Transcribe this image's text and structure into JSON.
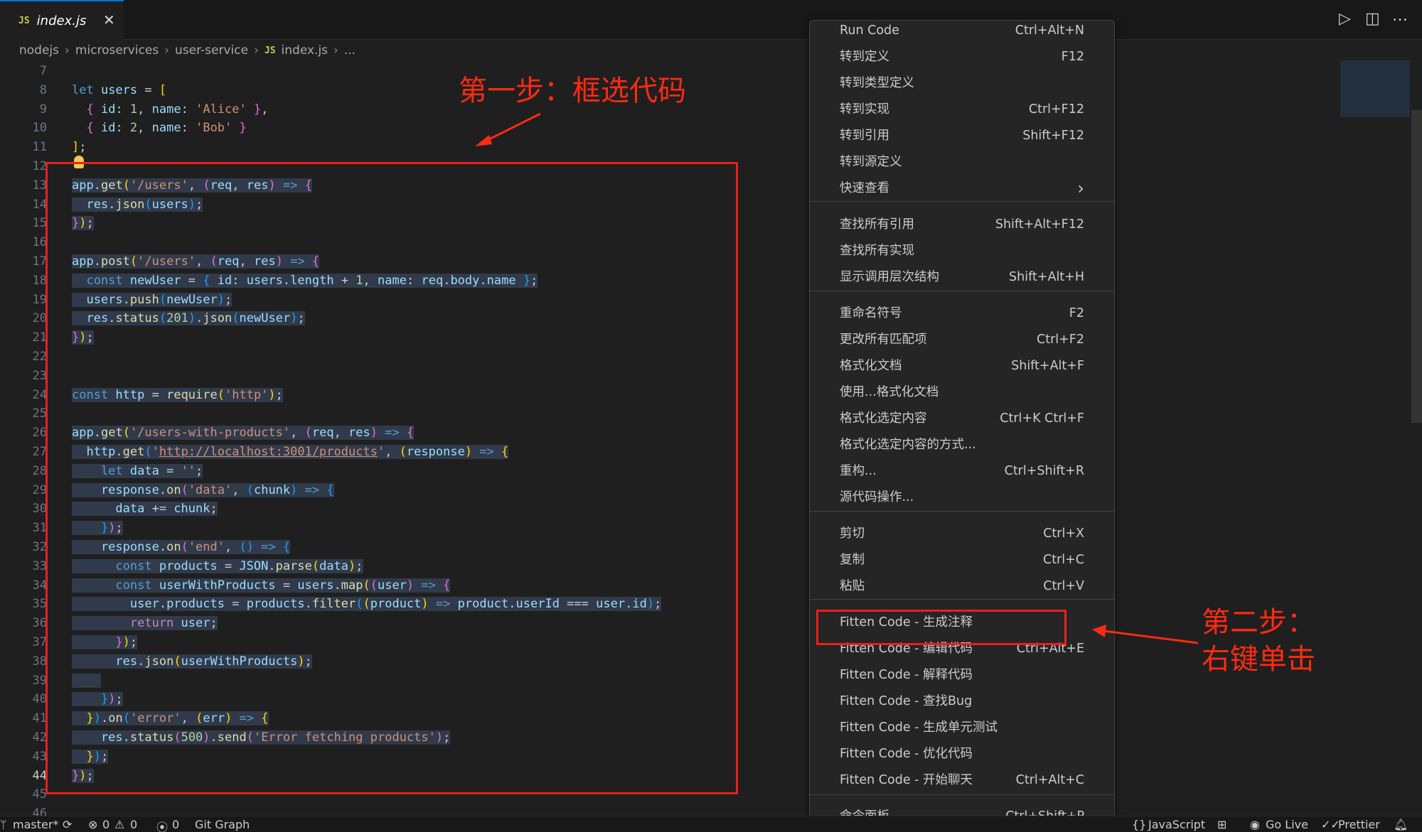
{
  "tab": {
    "badge": "JS",
    "name": "index.js",
    "close": "✕"
  },
  "toolbar": {
    "run": "▷",
    "split": "◫",
    "more": "…"
  },
  "breadcrumb": [
    "nodejs",
    "microservices",
    "user-service",
    "index.js",
    "..."
  ],
  "breadcrumb_badge": "JS",
  "gutter": [
    "7",
    "8",
    "9",
    "10",
    "11",
    "12",
    "13",
    "14",
    "15",
    "16",
    "17",
    "18",
    "19",
    "20",
    "21",
    "22",
    "23",
    "24",
    "25",
    "26",
    "27",
    "28",
    "29",
    "30",
    "31",
    "32",
    "33",
    "34",
    "35",
    "36",
    "37",
    "38",
    "39",
    "40",
    "41",
    "42",
    "43",
    "44",
    "45",
    "46"
  ],
  "annotations": {
    "step1": "第一步：框选代码",
    "step2_line1": "第二步：",
    "step2_line2": "右键单击"
  },
  "menu": {
    "items": [
      {
        "label": "Run Code",
        "shortcut": "Ctrl+Alt+N"
      },
      {
        "label": "转到定义",
        "shortcut": "F12"
      },
      {
        "label": "转到类型定义",
        "shortcut": ""
      },
      {
        "label": "转到实现",
        "shortcut": "Ctrl+F12"
      },
      {
        "label": "转到引用",
        "shortcut": "Shift+F12"
      },
      {
        "label": "转到源定义",
        "shortcut": ""
      },
      {
        "label": "快速查看",
        "shortcut": "›"
      },
      {
        "label": "查找所有引用",
        "shortcut": "Shift+Alt+F12"
      },
      {
        "label": "查找所有实现",
        "shortcut": ""
      },
      {
        "label": "显示调用层次结构",
        "shortcut": "Shift+Alt+H"
      },
      {
        "label": "重命名符号",
        "shortcut": "F2"
      },
      {
        "label": "更改所有匹配项",
        "shortcut": "Ctrl+F2"
      },
      {
        "label": "格式化文档",
        "shortcut": "Shift+Alt+F"
      },
      {
        "label": "使用...格式化文档",
        "shortcut": ""
      },
      {
        "label": "格式化选定内容",
        "shortcut": "Ctrl+K Ctrl+F"
      },
      {
        "label": "格式化选定内容的方式...",
        "shortcut": ""
      },
      {
        "label": "重构...",
        "shortcut": "Ctrl+Shift+R"
      },
      {
        "label": "源代码操作...",
        "shortcut": ""
      },
      {
        "label": "剪切",
        "shortcut": "Ctrl+X"
      },
      {
        "label": "复制",
        "shortcut": "Ctrl+C"
      },
      {
        "label": "粘贴",
        "shortcut": "Ctrl+V"
      },
      {
        "label": "Fitten Code - 生成注释",
        "shortcut": ""
      },
      {
        "label": "Fitten Code - 编辑代码",
        "shortcut": "Ctrl+Alt+E"
      },
      {
        "label": "Fitten Code - 解释代码",
        "shortcut": ""
      },
      {
        "label": "Fitten Code - 查找Bug",
        "shortcut": ""
      },
      {
        "label": "Fitten Code - 生成单元测试",
        "shortcut": ""
      },
      {
        "label": "Fitten Code - 优化代码",
        "shortcut": ""
      },
      {
        "label": "Fitten Code - 开始聊天",
        "shortcut": "Ctrl+Alt+C"
      },
      {
        "label": "命令面板...",
        "shortcut": "Ctrl+Shift+P"
      }
    ]
  },
  "status": {
    "branch": "master*",
    "errors": "0",
    "warnings": "0",
    "ports": "0",
    "git_graph": "Git Graph",
    "language": "JavaScript",
    "golive": "Go Live",
    "prettier": "Prettier"
  },
  "code": [
    [],
    [
      [
        "let ",
        "k"
      ],
      [
        "users",
        "v"
      ],
      [
        " = ",
        "p"
      ],
      [
        "[",
        "b1"
      ]
    ],
    [
      [
        "  { ",
        "b2"
      ],
      [
        "id",
        "v"
      ],
      [
        ": ",
        "p"
      ],
      [
        "1",
        "n"
      ],
      [
        ", ",
        "p"
      ],
      [
        "name",
        "v"
      ],
      [
        ": ",
        "p"
      ],
      [
        "'Alice'",
        "s"
      ],
      [
        " }",
        "b2"
      ],
      [
        ",",
        "p"
      ]
    ],
    [
      [
        "  { ",
        "b2"
      ],
      [
        "id",
        "v"
      ],
      [
        ": ",
        "p"
      ],
      [
        "2",
        "n"
      ],
      [
        ", ",
        "p"
      ],
      [
        "name",
        "v"
      ],
      [
        ": ",
        "p"
      ],
      [
        "'Bob'",
        "s"
      ],
      [
        " }",
        "b2"
      ]
    ],
    [
      [
        "]",
        "b1"
      ],
      [
        ";",
        "p"
      ]
    ],
    [],
    [
      [
        "app",
        "v"
      ],
      [
        ".",
        "p"
      ],
      [
        "get",
        "f"
      ],
      [
        "(",
        "b1"
      ],
      [
        "'/users'",
        "s"
      ],
      [
        ", ",
        "p"
      ],
      [
        "(",
        "b2"
      ],
      [
        "req",
        "v"
      ],
      [
        ", ",
        "p"
      ],
      [
        "res",
        "v"
      ],
      [
        ")",
        "b2"
      ],
      [
        " => ",
        "k"
      ],
      [
        "{",
        "b2"
      ]
    ],
    [
      [
        "  res",
        "v"
      ],
      [
        ".",
        "p"
      ],
      [
        "json",
        "f"
      ],
      [
        "(",
        "b3"
      ],
      [
        "users",
        "v"
      ],
      [
        ")",
        "b3"
      ],
      [
        ";",
        "p"
      ]
    ],
    [
      [
        "}",
        "b2"
      ],
      [
        ")",
        "b1"
      ],
      [
        ";",
        "p"
      ]
    ],
    [],
    [
      [
        "app",
        "v"
      ],
      [
        ".",
        "p"
      ],
      [
        "post",
        "f"
      ],
      [
        "(",
        "b1"
      ],
      [
        "'/users'",
        "s"
      ],
      [
        ", ",
        "p"
      ],
      [
        "(",
        "b2"
      ],
      [
        "req",
        "v"
      ],
      [
        ", ",
        "p"
      ],
      [
        "res",
        "v"
      ],
      [
        ")",
        "b2"
      ],
      [
        " => ",
        "k"
      ],
      [
        "{",
        "b2"
      ]
    ],
    [
      [
        "  const ",
        "k"
      ],
      [
        "newUser",
        "v"
      ],
      [
        " = ",
        "p"
      ],
      [
        "{ ",
        "b3"
      ],
      [
        "id",
        "v"
      ],
      [
        ": ",
        "p"
      ],
      [
        "users",
        "v"
      ],
      [
        ".",
        "p"
      ],
      [
        "length",
        "v"
      ],
      [
        " + ",
        "p"
      ],
      [
        "1",
        "n"
      ],
      [
        ", ",
        "p"
      ],
      [
        "name",
        "v"
      ],
      [
        ": ",
        "p"
      ],
      [
        "req",
        "v"
      ],
      [
        ".",
        "p"
      ],
      [
        "body",
        "v"
      ],
      [
        ".",
        "p"
      ],
      [
        "name",
        "v"
      ],
      [
        " }",
        "b3"
      ],
      [
        ";",
        "p"
      ]
    ],
    [
      [
        "  users",
        "v"
      ],
      [
        ".",
        "p"
      ],
      [
        "push",
        "f"
      ],
      [
        "(",
        "b3"
      ],
      [
        "newUser",
        "v"
      ],
      [
        ")",
        "b3"
      ],
      [
        ";",
        "p"
      ]
    ],
    [
      [
        "  res",
        "v"
      ],
      [
        ".",
        "p"
      ],
      [
        "status",
        "f"
      ],
      [
        "(",
        "b3"
      ],
      [
        "201",
        "n"
      ],
      [
        ")",
        "b3"
      ],
      [
        ".",
        "p"
      ],
      [
        "json",
        "f"
      ],
      [
        "(",
        "b3"
      ],
      [
        "newUser",
        "v"
      ],
      [
        ")",
        "b3"
      ],
      [
        ";",
        "p"
      ]
    ],
    [
      [
        "}",
        "b2"
      ],
      [
        ")",
        "b1"
      ],
      [
        ";",
        "p"
      ]
    ],
    [],
    [],
    [
      [
        "const ",
        "k"
      ],
      [
        "http",
        "v"
      ],
      [
        " = ",
        "p"
      ],
      [
        "require",
        "f"
      ],
      [
        "(",
        "b1"
      ],
      [
        "'http'",
        "s"
      ],
      [
        ")",
        "b1"
      ],
      [
        ";",
        "p"
      ]
    ],
    [],
    [
      [
        "app",
        "v"
      ],
      [
        ".",
        "p"
      ],
      [
        "get",
        "f"
      ],
      [
        "(",
        "b1"
      ],
      [
        "'/users-with-products'",
        "s"
      ],
      [
        ", ",
        "p"
      ],
      [
        "(",
        "b2"
      ],
      [
        "req",
        "v"
      ],
      [
        ", ",
        "p"
      ],
      [
        "res",
        "v"
      ],
      [
        ")",
        "b2"
      ],
      [
        " => ",
        "k"
      ],
      [
        "{",
        "b2"
      ]
    ],
    [
      [
        "  http",
        "v"
      ],
      [
        ".",
        "p"
      ],
      [
        "get",
        "f"
      ],
      [
        "(",
        "b3"
      ],
      [
        "'",
        "s"
      ],
      [
        "http://localhost:3001/products",
        "s u"
      ],
      [
        "'",
        "s"
      ],
      [
        ", ",
        "p"
      ],
      [
        "(",
        "b1"
      ],
      [
        "response",
        "v"
      ],
      [
        ")",
        "b1"
      ],
      [
        " => ",
        "k"
      ],
      [
        "{",
        "b1"
      ]
    ],
    [
      [
        "    let ",
        "k"
      ],
      [
        "data",
        "v"
      ],
      [
        " = ",
        "p"
      ],
      [
        "''",
        "s"
      ],
      [
        ";",
        "p"
      ]
    ],
    [
      [
        "    response",
        "v"
      ],
      [
        ".",
        "p"
      ],
      [
        "on",
        "f"
      ],
      [
        "(",
        "b2"
      ],
      [
        "'data'",
        "s"
      ],
      [
        ", ",
        "p"
      ],
      [
        "(",
        "b3"
      ],
      [
        "chunk",
        "v"
      ],
      [
        ")",
        "b3"
      ],
      [
        " => ",
        "k"
      ],
      [
        "{",
        "b3"
      ]
    ],
    [
      [
        "      data",
        "v"
      ],
      [
        " += ",
        "p"
      ],
      [
        "chunk",
        "v"
      ],
      [
        ";",
        "p"
      ]
    ],
    [
      [
        "    }",
        "b3"
      ],
      [
        ")",
        "b2"
      ],
      [
        ";",
        "p"
      ]
    ],
    [
      [
        "    response",
        "v"
      ],
      [
        ".",
        "p"
      ],
      [
        "on",
        "f"
      ],
      [
        "(",
        "b2"
      ],
      [
        "'end'",
        "s"
      ],
      [
        ", ",
        "p"
      ],
      [
        "()",
        "b3"
      ],
      [
        " => ",
        "k"
      ],
      [
        "{",
        "b3"
      ]
    ],
    [
      [
        "      const ",
        "k"
      ],
      [
        "products",
        "v"
      ],
      [
        " = ",
        "p"
      ],
      [
        "JSON",
        "v"
      ],
      [
        ".",
        "p"
      ],
      [
        "parse",
        "f"
      ],
      [
        "(",
        "b1"
      ],
      [
        "data",
        "v"
      ],
      [
        ")",
        "b1"
      ],
      [
        ";",
        "p"
      ]
    ],
    [
      [
        "      const ",
        "k"
      ],
      [
        "userWithProducts",
        "v"
      ],
      [
        " = ",
        "p"
      ],
      [
        "users",
        "v"
      ],
      [
        ".",
        "p"
      ],
      [
        "map",
        "f"
      ],
      [
        "(",
        "b1"
      ],
      [
        "(",
        "b2"
      ],
      [
        "user",
        "v"
      ],
      [
        ")",
        "b2"
      ],
      [
        " => ",
        "k"
      ],
      [
        "{",
        "b2"
      ]
    ],
    [
      [
        "        user",
        "v"
      ],
      [
        ".",
        "p"
      ],
      [
        "products",
        "v"
      ],
      [
        " = ",
        "p"
      ],
      [
        "products",
        "v"
      ],
      [
        ".",
        "p"
      ],
      [
        "filter",
        "f"
      ],
      [
        "(",
        "b3"
      ],
      [
        "(",
        "b1"
      ],
      [
        "product",
        "v"
      ],
      [
        ")",
        "b1"
      ],
      [
        " => ",
        "k"
      ],
      [
        "product",
        "v"
      ],
      [
        ".",
        "p"
      ],
      [
        "userId",
        "v"
      ],
      [
        " === ",
        "p"
      ],
      [
        "user",
        "v"
      ],
      [
        ".",
        "p"
      ],
      [
        "id",
        "v"
      ],
      [
        ")",
        "b3"
      ],
      [
        ";",
        "p"
      ]
    ],
    [
      [
        "        return ",
        "kw2"
      ],
      [
        "user",
        "v"
      ],
      [
        ";",
        "p"
      ]
    ],
    [
      [
        "      }",
        "b2"
      ],
      [
        ")",
        "b1"
      ],
      [
        ";",
        "p"
      ]
    ],
    [
      [
        "      res",
        "v"
      ],
      [
        ".",
        "p"
      ],
      [
        "json",
        "f"
      ],
      [
        "(",
        "b1"
      ],
      [
        "userWithProducts",
        "v"
      ],
      [
        ")",
        "b1"
      ],
      [
        ";",
        "p"
      ]
    ],
    [
      [
        "    ",
        "p"
      ]
    ],
    [
      [
        "    }",
        "b3"
      ],
      [
        ")",
        "b2"
      ],
      [
        ";",
        "p"
      ]
    ],
    [
      [
        "  }",
        "b1"
      ],
      [
        ")",
        "b3"
      ],
      [
        ".",
        "p"
      ],
      [
        "on",
        "f"
      ],
      [
        "(",
        "b3"
      ],
      [
        "'error'",
        "s"
      ],
      [
        ", ",
        "p"
      ],
      [
        "(",
        "b1"
      ],
      [
        "err",
        "v"
      ],
      [
        ")",
        "b1"
      ],
      [
        " => ",
        "k"
      ],
      [
        "{",
        "b1"
      ]
    ],
    [
      [
        "    res",
        "v"
      ],
      [
        ".",
        "p"
      ],
      [
        "status",
        "f"
      ],
      [
        "(",
        "b2"
      ],
      [
        "500",
        "n"
      ],
      [
        ")",
        "b2"
      ],
      [
        ".",
        "p"
      ],
      [
        "send",
        "f"
      ],
      [
        "(",
        "b2"
      ],
      [
        "'Error fetching products'",
        "s"
      ],
      [
        ")",
        "b2"
      ],
      [
        ";",
        "p"
      ]
    ],
    [
      [
        "  }",
        "b1"
      ],
      [
        ")",
        "b3"
      ],
      [
        ";",
        "p"
      ]
    ],
    [
      [
        "}",
        "b2"
      ],
      [
        ")",
        "b1"
      ],
      [
        ";",
        "p"
      ]
    ],
    [],
    []
  ]
}
